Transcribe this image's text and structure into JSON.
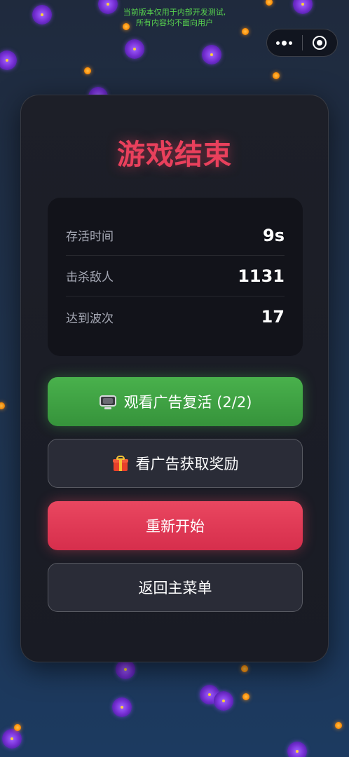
{
  "notice": {
    "line1": "当前版本仅用于内部开发测试,",
    "line2": "所有内容均不面向用户"
  },
  "capsule": {
    "more_icon": "more-dots-icon",
    "close_icon": "target-circle-icon"
  },
  "modal": {
    "title": "游戏结束",
    "stats": [
      {
        "label": "存活时间",
        "value": "9s"
      },
      {
        "label": "击杀敌人",
        "value": "1131"
      },
      {
        "label": "达到波次",
        "value": "17"
      }
    ],
    "buttons": {
      "revive": {
        "label": "观看广告复活 (2/2)",
        "icon": "tv-icon"
      },
      "reward": {
        "label": "看广告获取奖励",
        "icon": "gift-icon"
      },
      "restart": {
        "label": "重新开始"
      },
      "main_menu": {
        "label": "返回主菜单"
      }
    }
  },
  "colors": {
    "title": "#e9405c",
    "revive_button": "#43a547",
    "restart_button": "#e03a56",
    "notice_text": "#58d34f"
  }
}
